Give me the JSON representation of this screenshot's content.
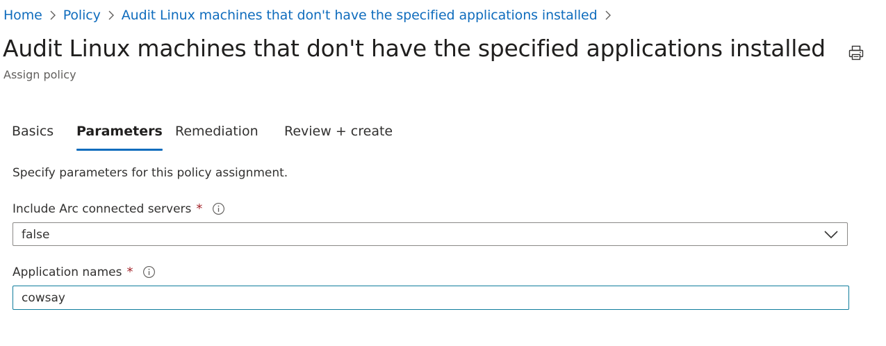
{
  "breadcrumb": {
    "items": [
      "Home",
      "Policy",
      "Audit Linux machines that don't have the specified applications installed"
    ]
  },
  "header": {
    "title": "Audit Linux machines that don't have the specified applications installed",
    "subtitle": "Assign policy",
    "print_icon": "print-icon"
  },
  "tabs": [
    {
      "label": "Basics",
      "active": false
    },
    {
      "label": "Parameters",
      "active": true
    },
    {
      "label": "Remediation",
      "active": false
    },
    {
      "label": "Review + create",
      "active": false
    }
  ],
  "main": {
    "description": "Specify parameters for this policy assignment.",
    "fields": [
      {
        "label": "Include Arc connected servers",
        "required_marker": "*",
        "type": "dropdown",
        "value": "false"
      },
      {
        "label": "Application names",
        "required_marker": "*",
        "type": "text",
        "value": "cowsay"
      }
    ]
  },
  "colors": {
    "link": "#0f6cbd",
    "required": "#a4262c",
    "active_tab_underline": "#0f6cbd",
    "focused_input_border": "#0f7c9c"
  }
}
